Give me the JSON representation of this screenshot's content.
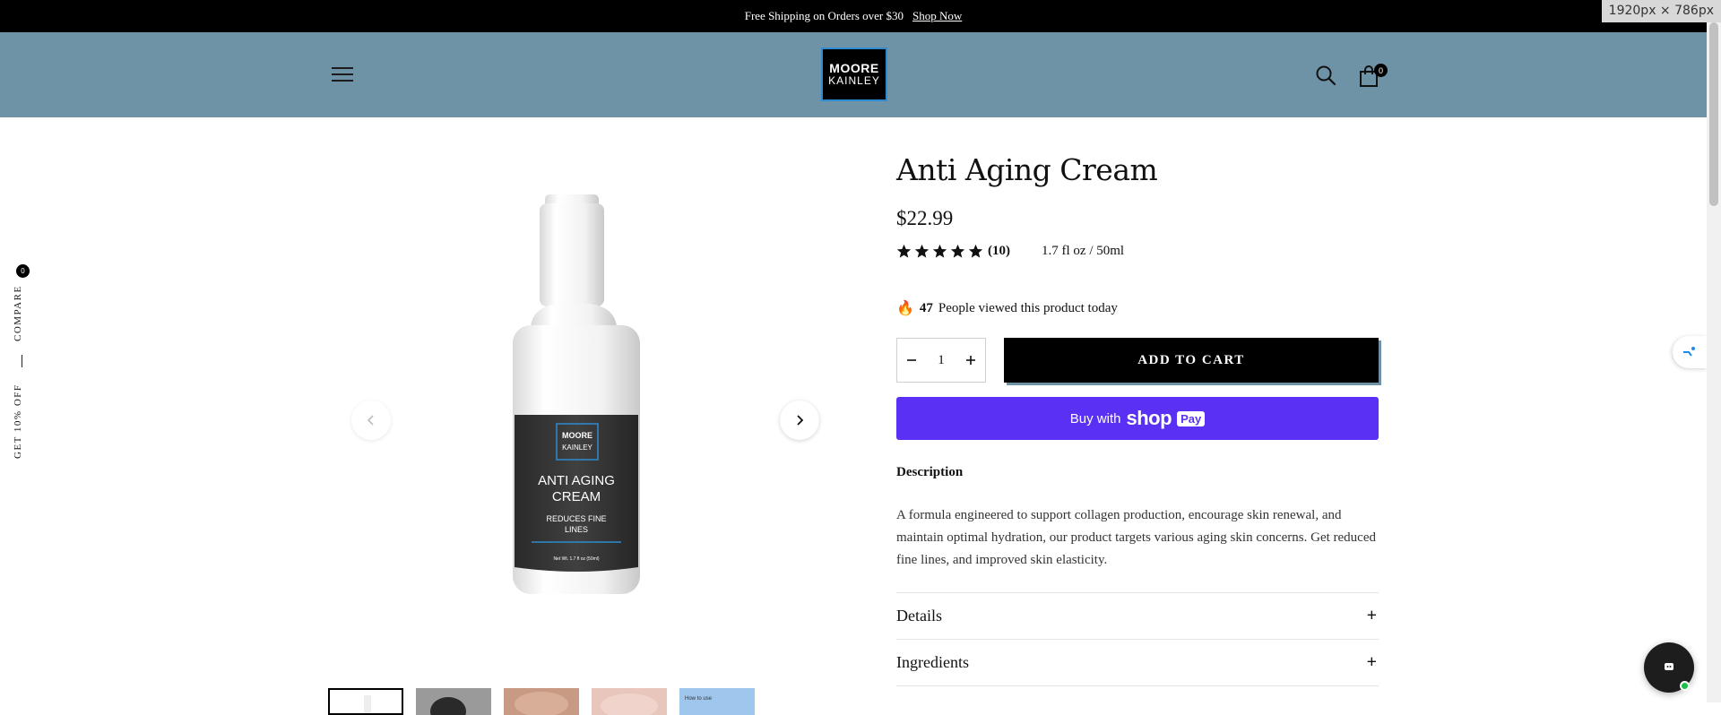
{
  "announcement": {
    "text": "Free Shipping on Orders over $30",
    "link": "Shop Now"
  },
  "dimensions_badge": "1920px × 786px",
  "header": {
    "logo_line1": "MOORE",
    "logo_line2": "KAINLEY",
    "cart_count": "0"
  },
  "side_tab": {
    "compare_count": "0",
    "compare_label": "COMPARE",
    "offer_label": "GET 10% OFF"
  },
  "product": {
    "title": "Anti Aging Cream",
    "price": "$22.99",
    "rating_stars": 5,
    "review_count": "(10)",
    "size": "1.7 fl oz / 50ml",
    "viewers_count": "47",
    "viewers_text": "People viewed this product today",
    "quantity": "1",
    "add_to_cart": "ADD TO CART",
    "buy_with": "Buy with",
    "shop_word": "shop",
    "pay_word": "Pay",
    "description_heading": "Description",
    "description": "A formula engineered to support collagen production, encourage skin renewal, and maintain optimal hydration, our product targets various aging skin concerns. Get reduced fine lines, and improved skin elasticity.",
    "accordions": [
      "Details",
      "Ingredients"
    ],
    "label": {
      "brand1": "MOORE",
      "brand2": "KAINLEY",
      "name1": "ANTI AGING",
      "name2": "CREAM",
      "claim1": "REDUCES FINE",
      "claim2": "LINES",
      "net": "Net Wt. 1.7 fl oz (50ml)"
    }
  },
  "thumbnails": {
    "last_label": "How to use"
  },
  "colors": {
    "header_bg": "#6e93a6",
    "shop_pay": "#5a31f4",
    "announce_bg": "#000000"
  }
}
